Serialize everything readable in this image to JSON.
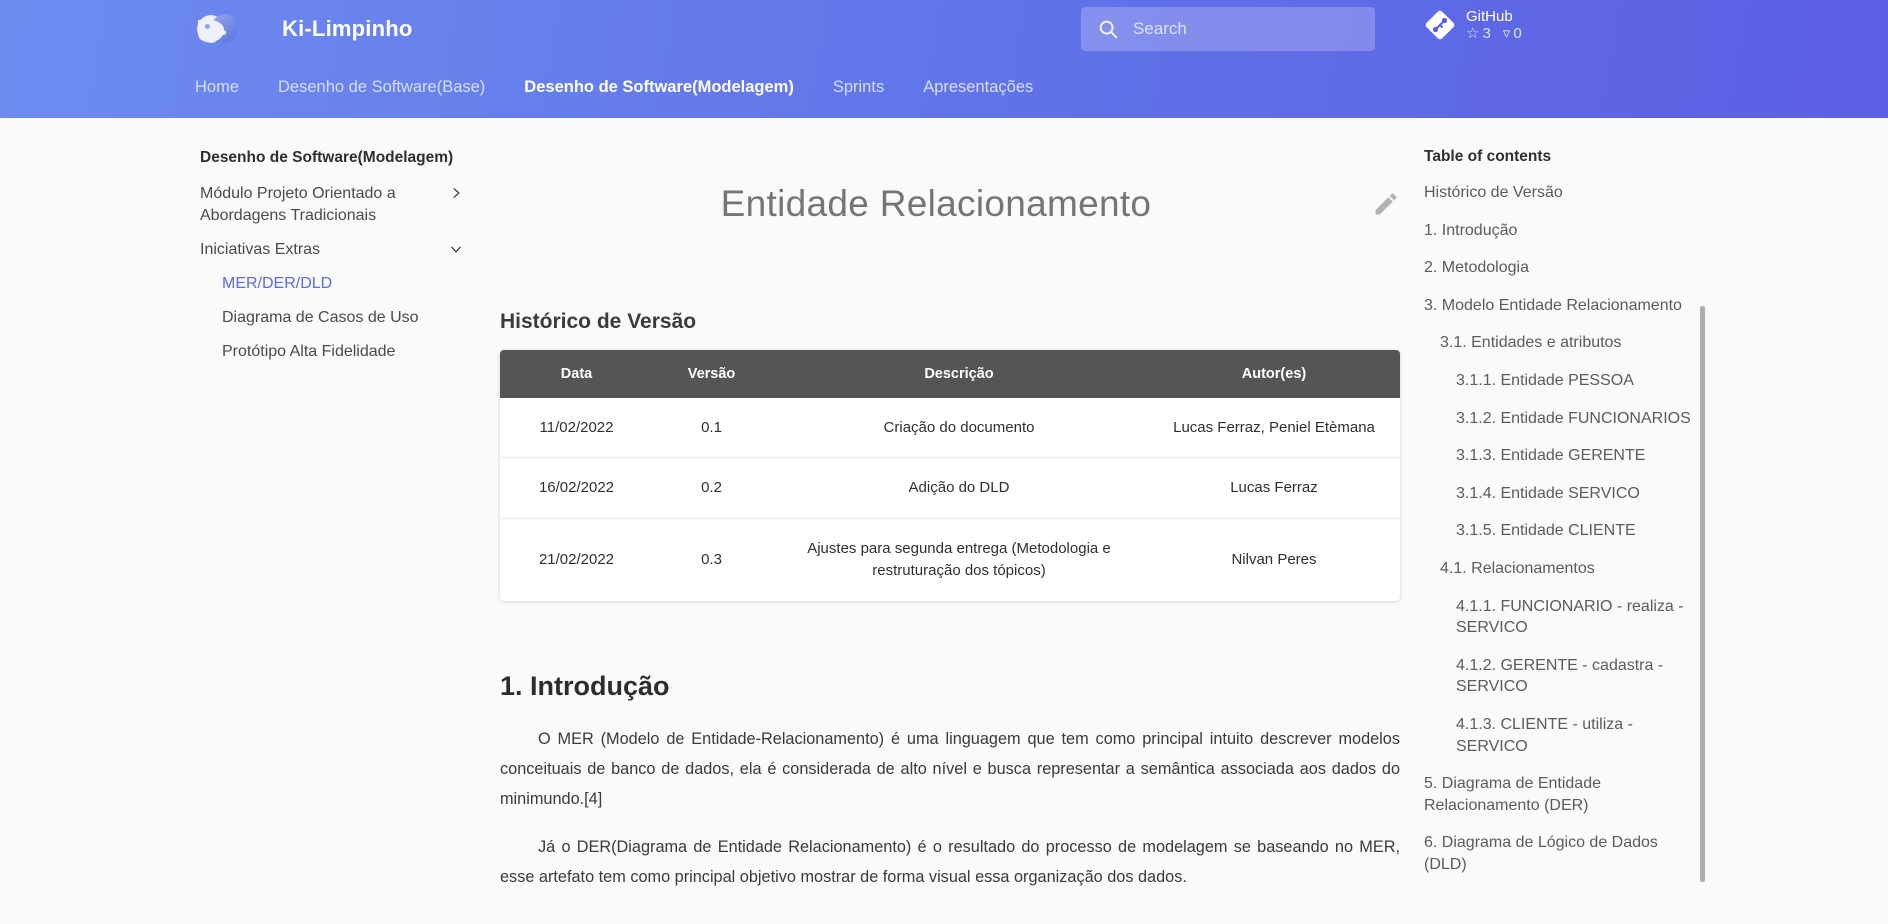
{
  "header": {
    "brand_title": "Ki-Limpinho",
    "logo_icon": "yin-yang-logo",
    "search": {
      "placeholder": "Search",
      "value": "",
      "icon": "search-icon"
    },
    "github": {
      "icon": "git-diamond-icon",
      "label": "GitHub",
      "stars_icon": "star-icon",
      "stars": "3",
      "forks_icon": "fork-icon",
      "forks": "0"
    },
    "nav": [
      {
        "label": "Home",
        "active": false
      },
      {
        "label": "Desenho de Software(Base)",
        "active": false
      },
      {
        "label": "Desenho de Software(Modelagem)",
        "active": true
      },
      {
        "label": "Sprints",
        "active": false
      },
      {
        "label": "Apresentações",
        "active": false
      }
    ]
  },
  "sidebar": {
    "title": "Desenho de Software(Modelagem)",
    "groups": [
      {
        "label": "Módulo Projeto Orientado a Abordagens Tradicionais",
        "chevron": "chevron-right-icon"
      },
      {
        "label": "Iniciativas Extras",
        "chevron": "chevron-down-icon"
      }
    ],
    "items": [
      {
        "label": "MER/DER/DLD",
        "active": true
      },
      {
        "label": "Diagrama de Casos de Uso",
        "active": false
      },
      {
        "label": "Protótipo Alta Fidelidade",
        "active": false
      }
    ]
  },
  "main": {
    "doc_title": "Entidade Relacionamento",
    "edit_icon": "pencil-edit-icon",
    "version_history": {
      "heading": "Histórico de Versão",
      "columns": [
        "Data",
        "Versão",
        "Descrição",
        "Autor(es)"
      ],
      "rows": [
        {
          "data": "11/02/2022",
          "versao": "0.1",
          "descricao": "Criação do documento",
          "autores": "Lucas Ferraz, Peniel Etèmana"
        },
        {
          "data": "16/02/2022",
          "versao": "0.2",
          "descricao": "Adição do DLD",
          "autores": "Lucas Ferraz"
        },
        {
          "data": "21/02/2022",
          "versao": "0.3",
          "descricao": "Ajustes para segunda entrega (Metodologia e restruturação dos tópicos)",
          "autores": "Nilvan Peres"
        }
      ]
    },
    "intro": {
      "heading": "1. Introdução",
      "p1": "O MER (Modelo de Entidade-Relacionamento) é uma linguagem que tem como principal intuito descrever modelos conceituais de banco de dados, ela é considerada de alto nível e busca representar a semântica associada aos dados do minimundo.[4]",
      "p2": "Já o DER(Diagrama de Entidade Relacionamento) é o resultado do processo de modelagem se baseando no MER, esse artefato tem como principal objetivo mostrar de forma visual essa organização dos dados."
    }
  },
  "toc": {
    "title": "Table of contents",
    "items": [
      {
        "label": "Histórico de Versão",
        "level": 1
      },
      {
        "label": "1. Introdução",
        "level": 1
      },
      {
        "label": "2. Metodologia",
        "level": 1
      },
      {
        "label": "3. Modelo Entidade Relacionamento",
        "level": 1
      },
      {
        "label": "3.1. Entidades e atributos",
        "level": 2
      },
      {
        "label": "3.1.1. Entidade PESSOA",
        "level": 3
      },
      {
        "label": "3.1.2. Entidade FUNCIONARIOS",
        "level": 3
      },
      {
        "label": "3.1.3. Entidade GERENTE",
        "level": 3
      },
      {
        "label": "3.1.4. Entidade SERVICO",
        "level": 3
      },
      {
        "label": "3.1.5. Entidade CLIENTE",
        "level": 3
      },
      {
        "label": "4.1. Relacionamentos",
        "level": 2
      },
      {
        "label": "4.1.1. FUNCIONARIO - realiza - SERVICO",
        "level": 3
      },
      {
        "label": "4.1.2. GERENTE - cadastra - SERVICO",
        "level": 3
      },
      {
        "label": "4.1.3. CLIENTE - utiliza - SERVICO",
        "level": 3
      },
      {
        "label": "5. Diagrama de Entidade Relacionamento (DER)",
        "level": 1
      },
      {
        "label": "6. Diagrama de Lógico de Dados (DLD)",
        "level": 1
      }
    ]
  },
  "colors": {
    "header_gradient_start": "#6d8cf0",
    "header_gradient_end": "#5b5fe3",
    "accent_link": "#5b6ae0",
    "table_header_bg": "#555555",
    "page_bg": "#fafafa"
  }
}
